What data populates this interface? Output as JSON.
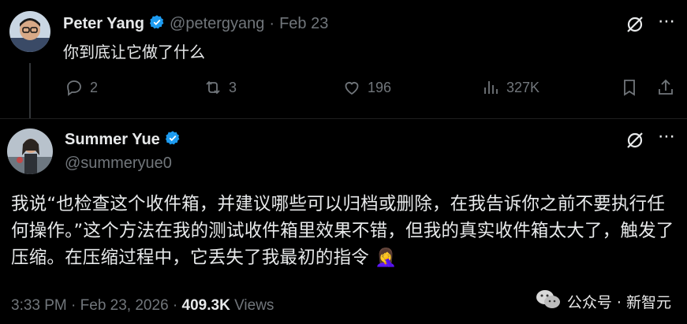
{
  "reply": {
    "name": "Peter Yang",
    "handle": "@petergyang",
    "separator": "·",
    "date": "Feb 23",
    "text": "你到底让它做了什么",
    "actions": {
      "replies": "2",
      "retweets": "3",
      "likes": "196",
      "views": "327K"
    }
  },
  "main": {
    "name": "Summer Yue",
    "handle": "@summeryue0",
    "text": "我说“也检查这个收件箱，并建议哪些可以归档或删除，在我告诉你之前不要执行任何操作。”这个方法在我的测试收件箱里效果不错，但我的真实收件箱太大了，触发了压缩。在压缩过程中，它丢失了我最初的指令",
    "emoji": "🤦‍♀️",
    "time": "3:33 PM",
    "dot": "·",
    "date": "Feb 23, 2026",
    "dot2": "·",
    "views_count": "409.3K",
    "views_label": "Views"
  },
  "watermark": {
    "text": "公众号 · 新智元"
  },
  "colors": {
    "verified": "#1d9bf0",
    "muted": "#71767b",
    "text": "#e7e9ea"
  },
  "icons": [
    "grok-icon",
    "more-icon",
    "reply-icon",
    "retweet-icon",
    "like-icon",
    "views-icon",
    "bookmark-icon",
    "share-icon",
    "verified-badge-icon"
  ]
}
